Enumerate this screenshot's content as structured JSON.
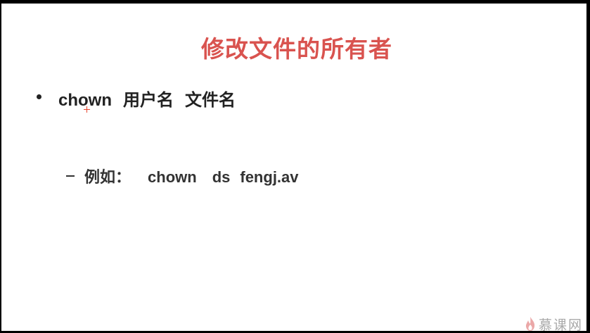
{
  "slide": {
    "title": "修改文件的所有者",
    "bullet": {
      "command": "chown",
      "arg1": "用户名",
      "arg2": "文件名"
    },
    "sub_bullet": {
      "label": "例如：",
      "command": "chown",
      "user": "ds",
      "file": "fengj.av"
    }
  },
  "watermark": {
    "text": "慕课网",
    "icon": "flame-icon"
  },
  "colors": {
    "title": "#d9534f",
    "body_text": "#222222",
    "cursor": "#e8452e",
    "watermark": "#9a9a9a"
  }
}
